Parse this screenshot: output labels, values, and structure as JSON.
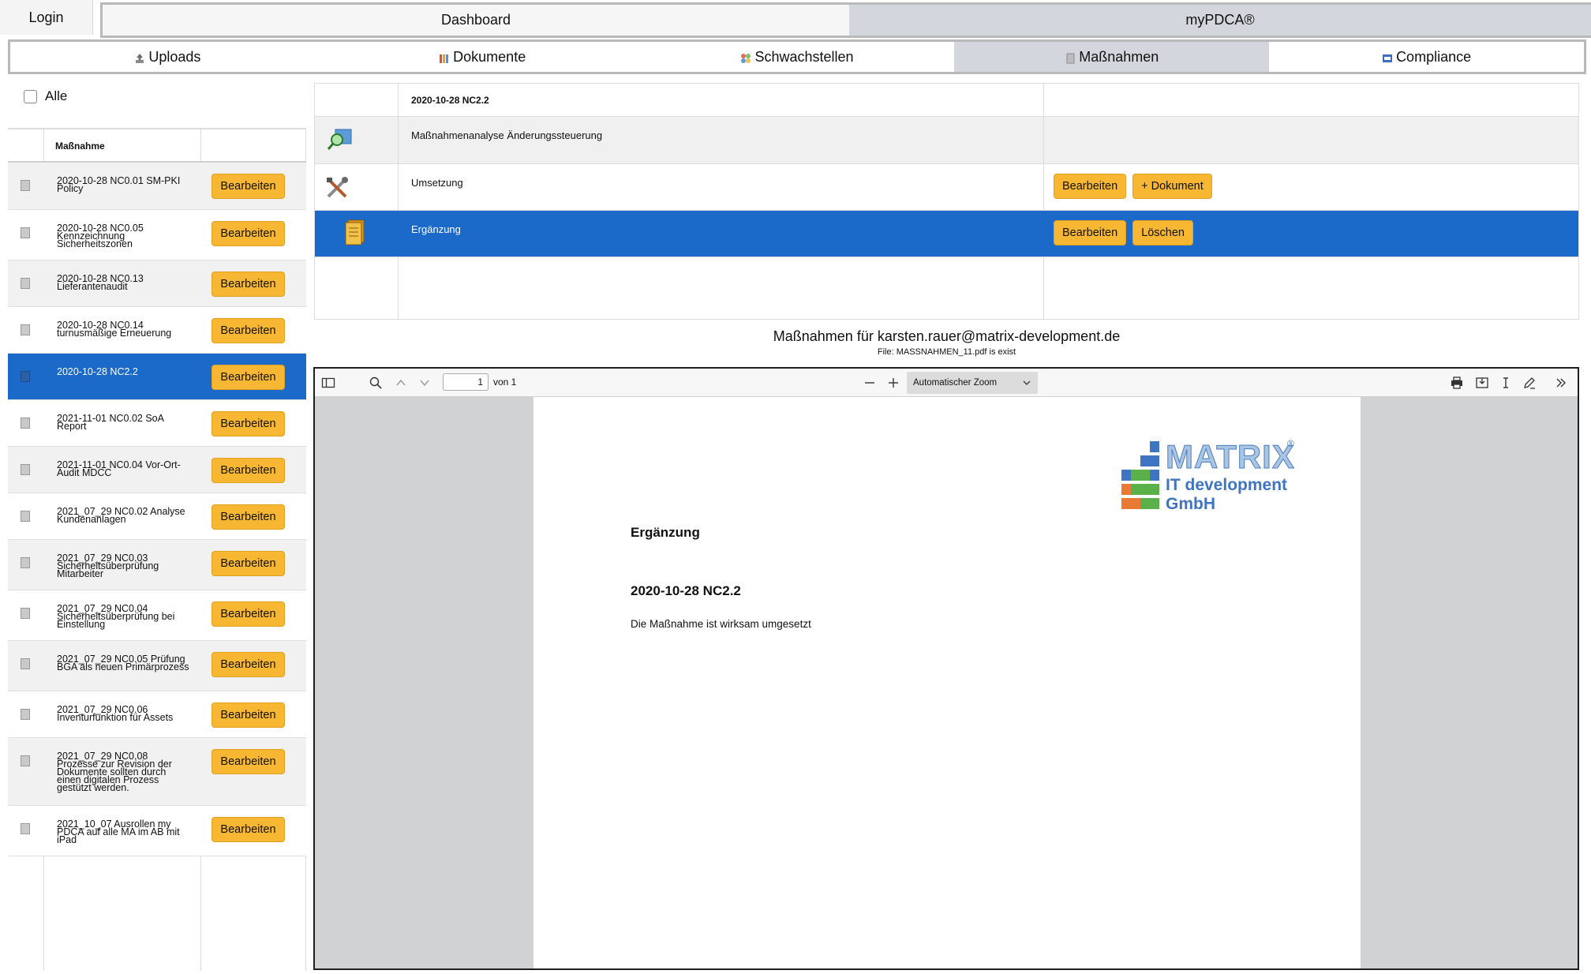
{
  "top": {
    "login": "Login",
    "tabs": [
      "Dashboard",
      "myPDCA®"
    ]
  },
  "modules": {
    "tabs": [
      {
        "label": "Uploads",
        "icon": "upload-icon"
      },
      {
        "label": "Dokumente",
        "icon": "documents-icon"
      },
      {
        "label": "Schwachstellen",
        "icon": "vulnerability-icon"
      },
      {
        "label": "Maßnahmen",
        "icon": "measures-icon"
      },
      {
        "label": "Compliance",
        "icon": "compliance-icon"
      }
    ],
    "active": "Maßnahmen"
  },
  "left": {
    "alle_label": "Alle",
    "column_header": "Maßnahme",
    "button_label": "Bearbeiten",
    "rows": [
      {
        "text": "2020-10-28 NC0.01 SM-PKI Policy"
      },
      {
        "text": "2020-10-28 NC0.05 Kennzeichnung Sicherheitszonen"
      },
      {
        "text": "2020-10-28 NC0.13 Lieferantenaudit"
      },
      {
        "text": "2020-10-28 NC0.14 turnusmäßige Erneuerung"
      },
      {
        "text": "2020-10-28 NC2.2"
      },
      {
        "text": "2021-11-01 NC0.02 SoA Report"
      },
      {
        "text": "2021-11-01 NC0.04 Vor-Ort-Audit MDCC"
      },
      {
        "text": "2021_07_29 NC0.02 Analyse Kundenanlagen"
      },
      {
        "text": "2021_07_29 NC0.03 Sicherheitsüberprüfung Mitarbeiter"
      },
      {
        "text": "2021_07_29 NC0.04 Sicherheitsüberprüfung bei Einstellung"
      },
      {
        "text": "2021_07_29 NC0.05 Prüfung BGA als neuen Primärprozess"
      },
      {
        "text": "2021_07_29 NC0.06 Inventurfunktion für Assets"
      },
      {
        "text": "2021_07_29 NC0.08 Prozesse zur Revision der Dokumente sollten durch einen digitalen Prozess gestützt werden."
      },
      {
        "text": "2021_10_07 Ausrollen my PDCA auf alle MA im AB mit iPad"
      }
    ]
  },
  "detail": {
    "header": "2020-10-28 NC2.2",
    "rows": [
      {
        "label": "Maßnahmenanalyse Änderungssteuerung",
        "icon": "magnifier-icon"
      },
      {
        "label": "Umsetzung",
        "icon": "tools-icon",
        "buttons": [
          "Bearbeiten",
          "+ Dokument"
        ]
      },
      {
        "label": "Ergänzung",
        "icon": "document-stack-icon",
        "buttons": [
          "Bearbeiten",
          "Löschen"
        ]
      }
    ]
  },
  "heading": {
    "title": "Maßnahmen für karsten.rauer@matrix-development.de",
    "file_status": "File: MASSNAHMEN_11.pdf is exist"
  },
  "viewer": {
    "page_number": "1",
    "page_total": "von 1",
    "zoom": "Automatischer Zoom",
    "pdf": {
      "logo_line1": "MATRIX",
      "logo_reg": "®",
      "logo_line2": "IT development",
      "logo_line3": "GmbH",
      "title": "Ergänzung",
      "subtitle": "2020-10-28 NC2.2",
      "body": "Die Maßnahme ist wirksam umgesetzt"
    }
  },
  "colors": {
    "accent_blue": "#1b6ac9",
    "button_yellow": "#f7b733",
    "tab_active": "#d3d6dc"
  }
}
